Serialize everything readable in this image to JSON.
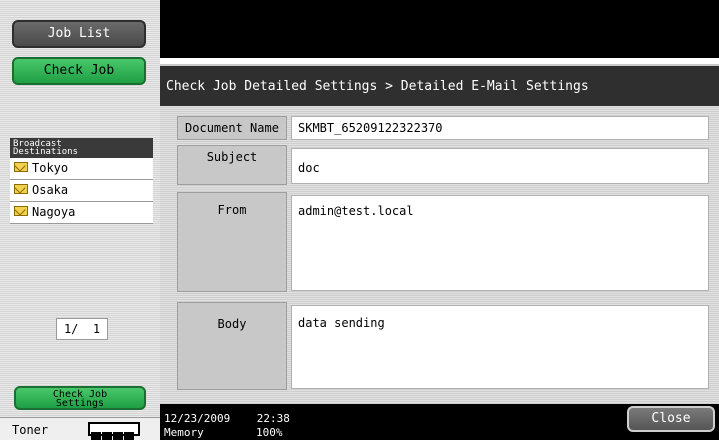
{
  "sidebar": {
    "job_list_label": "Job List",
    "check_job_label": "Check Job",
    "destinations_header": "Broadcast\nDestinations",
    "destinations": [
      {
        "name": "Tokyo"
      },
      {
        "name": "Osaka"
      },
      {
        "name": "Nagoya"
      }
    ],
    "page_indicator": "1/  1",
    "check_job_settings_label": "Check Job\nSettings",
    "toner_label": "Toner"
  },
  "header": {
    "breadcrumb": "Check Job Detailed Settings > Detailed E-Mail Settings"
  },
  "fields": {
    "document_name": {
      "label": "Document Name",
      "value": "SKMBT_65209122322370"
    },
    "subject": {
      "label": "Subject",
      "value": "doc"
    },
    "from": {
      "label": "From",
      "value": "admin@test.local"
    },
    "body": {
      "label": "Body",
      "value": "data sending"
    }
  },
  "status": {
    "datetime": "12/23/2009    22:38",
    "memory_label": "Memory",
    "memory_value": "100%",
    "close_label": "Close"
  },
  "colors": {
    "accent_green": "#2fb457",
    "dark": "#000000"
  }
}
